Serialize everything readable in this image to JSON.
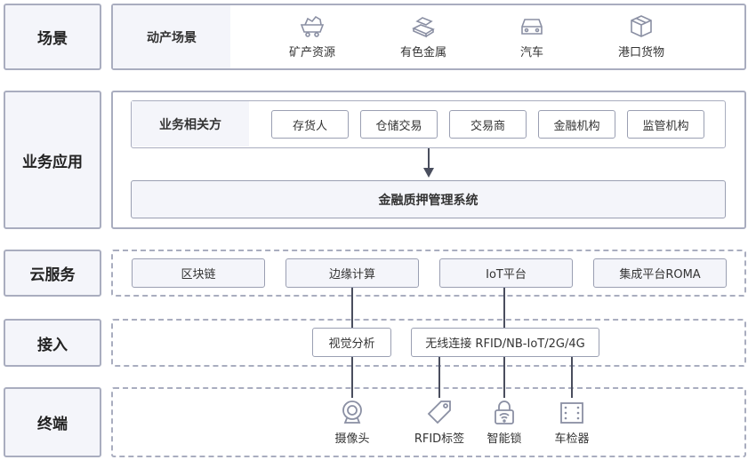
{
  "layers": {
    "scene": "场景",
    "business": "业务应用",
    "cloud": "云服务",
    "access": "接入",
    "terminal": "终端"
  },
  "scene": {
    "title": "动产场景",
    "items": [
      {
        "label": "矿产资源",
        "icon": "mine-cart-icon"
      },
      {
        "label": "有色金属",
        "icon": "metal-ingot-icon"
      },
      {
        "label": "汽车",
        "icon": "car-icon"
      },
      {
        "label": "港口货物",
        "icon": "cargo-box-icon"
      }
    ]
  },
  "business": {
    "parties_title": "业务相关方",
    "parties": [
      "存货人",
      "仓储交易",
      "交易商",
      "金融机构",
      "监管机构"
    ],
    "system": "金融质押管理系统"
  },
  "cloud": {
    "items": [
      "区块链",
      "边缘计算",
      "IoT平台",
      "集成平台ROMA"
    ]
  },
  "access": {
    "items": [
      "视觉分析",
      "无线连接 RFID/NB-IoT/2G/4G"
    ]
  },
  "terminal": {
    "items": [
      {
        "label": "摄像头",
        "icon": "camera-icon"
      },
      {
        "label": "RFID标签",
        "icon": "rfid-tag-icon"
      },
      {
        "label": "智能锁",
        "icon": "smart-lock-icon"
      },
      {
        "label": "车检器",
        "icon": "vehicle-detector-icon"
      }
    ]
  },
  "colors": {
    "border": "#a9adbf",
    "fill": "#f4f5fa",
    "connector": "#4a4e5e"
  }
}
